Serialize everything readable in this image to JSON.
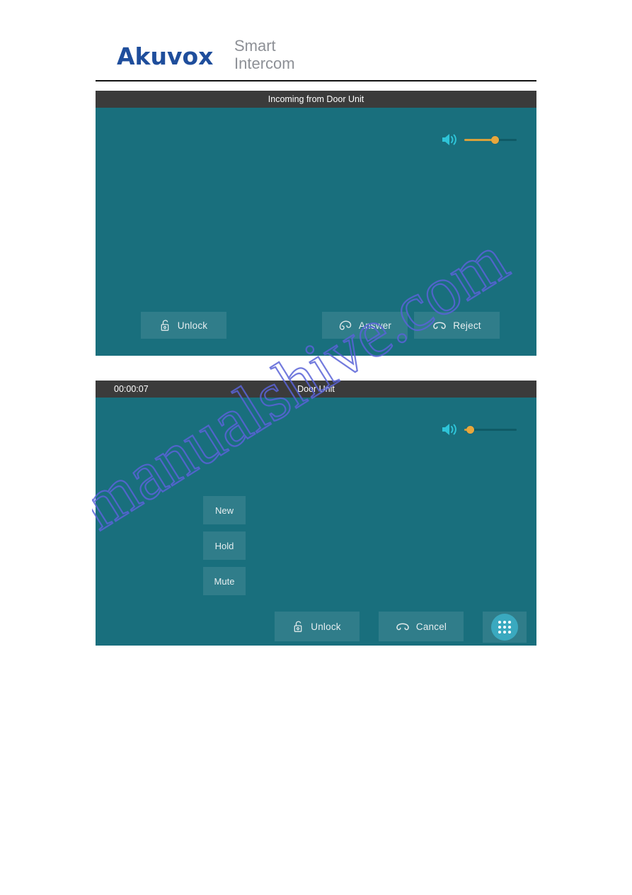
{
  "brand": {
    "name": "Akuvox",
    "tagline_line1": "Smart",
    "tagline_line2": "Intercom",
    "name_color": "#1f4e9c",
    "tagline_color": "#8d9096"
  },
  "watermark": {
    "text": "manualshive.com",
    "color": "#5a63d8"
  },
  "screens": [
    {
      "id": "incoming-call",
      "titlebar": {
        "center_text": "Incoming from Door Unit",
        "left_text": ""
      },
      "volume": {
        "icon": "speaker-icon",
        "level_percent": 58,
        "fill_color": "#d9a13b",
        "knob_color": "#e8a73c"
      },
      "buttons": [
        {
          "name": "unlock-button",
          "label": "Unlock",
          "icon": "padlock-icon"
        },
        {
          "name": "answer-button",
          "label": "Answer",
          "icon": "handset-answer-icon"
        },
        {
          "name": "reject-button",
          "label": "Reject",
          "icon": "handset-hangup-icon"
        }
      ],
      "background_color": "#196f7d"
    },
    {
      "id": "in-call",
      "titlebar": {
        "center_text": "Door Unit",
        "left_text": "00:00:07"
      },
      "volume": {
        "icon": "speaker-icon",
        "level_percent": 12,
        "fill_color": "#d9a13b",
        "knob_color": "#e8a73c"
      },
      "side_buttons": [
        {
          "name": "new-button",
          "label": "New"
        },
        {
          "name": "hold-button",
          "label": "Hold"
        },
        {
          "name": "mute-button",
          "label": "Mute"
        }
      ],
      "buttons": [
        {
          "name": "unlock-button",
          "label": "Unlock",
          "icon": "padlock-icon"
        },
        {
          "name": "cancel-button",
          "label": "Cancel",
          "icon": "handset-hangup-icon"
        }
      ],
      "keypad_button": {
        "name": "keypad-button",
        "icon": "dial-pad-icon",
        "label": ""
      },
      "background_color": "#196f7d"
    }
  ]
}
